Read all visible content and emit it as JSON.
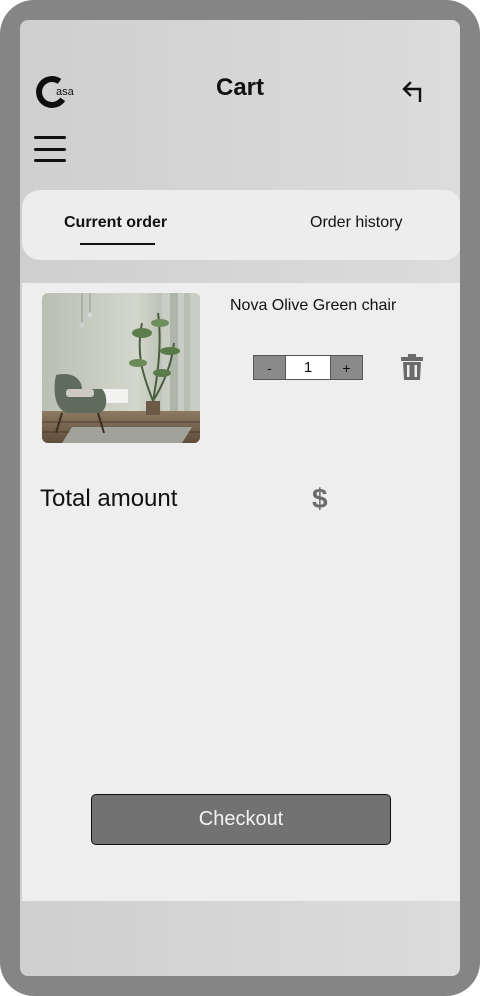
{
  "header": {
    "logo_text": "asa",
    "title": "Cart",
    "back_icon": "return-arrow-icon",
    "menu_icon": "hamburger-menu-icon"
  },
  "tabs": [
    {
      "label": "Current order",
      "active": true
    },
    {
      "label": "Order history",
      "active": false
    }
  ],
  "cart": {
    "items": [
      {
        "name": "Nova Olive Green chair",
        "quantity": "1",
        "decrement_label": "-",
        "increment_label": "+",
        "delete_icon": "trash-icon"
      }
    ],
    "total_label": "Total amount",
    "currency_symbol": "$"
  },
  "checkout_label": "Checkout",
  "colors": {
    "frame": "#858585",
    "button": "#727272",
    "panel": "#eeeeee"
  }
}
